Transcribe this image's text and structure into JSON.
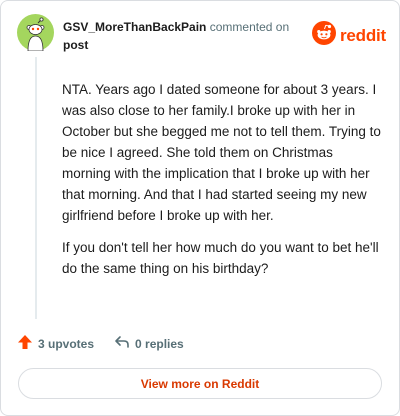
{
  "header": {
    "username": "GSV_MoreThanBackPain",
    "action_text": "commented on",
    "post_link": "post",
    "brand_wordmark": "reddit"
  },
  "comment": {
    "paragraphs": [
      "NTA. Years ago I dated someone for about 3 years. I was also close to her family.I broke up with her in October but she begged me not to tell them. Trying to be nice I agreed. She told them on Christmas morning with the implication that I broke up with her that morning. And that I had started seeing my new girlfriend before I broke up with her.",
      "If you don't tell her how much do you want to bet he'll do the same thing on his birthday?"
    ]
  },
  "actions": {
    "upvotes": "3 upvotes",
    "replies": "0 replies"
  },
  "footer": {
    "view_more_label": "View more on Reddit"
  },
  "icons": {
    "avatar": "snoo-avatar-icon",
    "logo": "reddit-logo-icon",
    "upvote": "upvote-arrow-icon",
    "reply": "reply-arrow-icon"
  },
  "colors": {
    "brand": "#ff4500",
    "upvote": "#ff4500",
    "avatar_bg": "#a4d65e",
    "link_text": "#d93900"
  }
}
